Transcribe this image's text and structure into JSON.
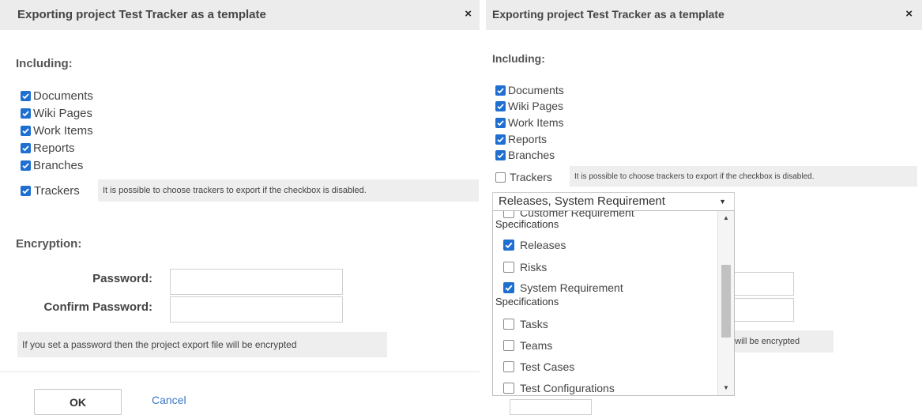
{
  "left": {
    "title": "Exporting project Test Tracker as a template",
    "close": "×",
    "including_heading": "Including:",
    "items": [
      {
        "label": "Documents",
        "checked": true
      },
      {
        "label": "Wiki Pages",
        "checked": true
      },
      {
        "label": "Work Items",
        "checked": true
      },
      {
        "label": "Reports",
        "checked": true
      },
      {
        "label": "Branches",
        "checked": true
      }
    ],
    "trackers": {
      "label": "Trackers",
      "checked": true
    },
    "trackers_info": "It is possible to choose trackers to export if the checkbox is disabled.",
    "encryption_heading": "Encryption:",
    "password_label": "Password:",
    "confirm_password_label": "Confirm Password:",
    "encryption_info": "If you set a password then the project export file will be encrypted",
    "ok_label": "OK",
    "cancel_label": "Cancel"
  },
  "right": {
    "title": "Exporting project Test Tracker as a template",
    "close": "×",
    "including_heading": "Including:",
    "items": [
      {
        "label": "Documents",
        "checked": true
      },
      {
        "label": "Wiki Pages",
        "checked": true
      },
      {
        "label": "Work Items",
        "checked": true
      },
      {
        "label": "Reports",
        "checked": true
      },
      {
        "label": "Branches",
        "checked": true
      }
    ],
    "trackers": {
      "label": "Trackers",
      "checked": false
    },
    "trackers_info": "It is possible to choose trackers to export if the checkbox is disabled.",
    "select_value": "Releases, System Requirement",
    "dropdown": {
      "partial_item": "Customer Requirement",
      "partial_item_suffix": "Specifications",
      "options": [
        {
          "label": "Releases",
          "checked": true
        },
        {
          "label": "Risks",
          "checked": false
        },
        {
          "label": "System Requirement",
          "checked": true
        },
        {
          "label": "Tasks",
          "checked": false
        },
        {
          "label": "Teams",
          "checked": false
        },
        {
          "label": "Test Cases",
          "checked": false
        },
        {
          "label": "Test Configurations",
          "checked": false
        }
      ],
      "system_requirement_suffix": "Specifications"
    },
    "encryption_info_tail": "e will be encrypted"
  },
  "colors": {
    "checkbox_on": "#1f6fd1",
    "link": "#3a78c3",
    "title_bar": "#ececec"
  }
}
